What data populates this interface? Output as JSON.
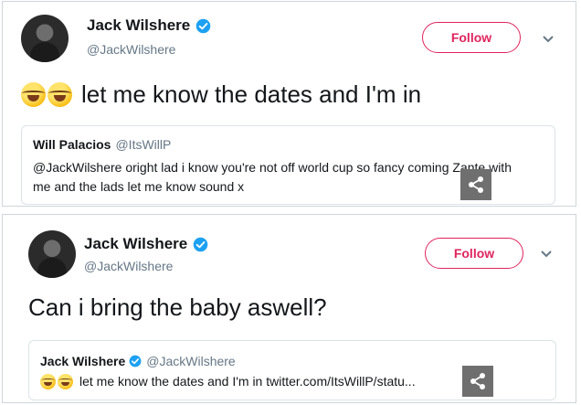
{
  "tweets": [
    {
      "author_name": "Jack Wilshere",
      "author_handle": "@JackWilshere",
      "follow_label": "Follow",
      "text": "let me know the dates and I'm in",
      "emoji_icons": [
        "rolling-on-floor-laughing-icon",
        "rolling-on-floor-laughing-icon"
      ],
      "quote": {
        "name": "Will Palacios",
        "handle": "@ItsWillP",
        "text_line1": "@JackWilshere oright lad i know you're not off world cup so fancy coming Zante with",
        "text_line2": "me and the lads let me know sound x"
      }
    },
    {
      "author_name": "Jack Wilshere",
      "author_handle": "@JackWilshere",
      "follow_label": "Follow",
      "text": "Can i bring the baby aswell?",
      "quote": {
        "name": "Jack Wilshere",
        "handle": "@JackWilshere",
        "text": "let me know the dates and I'm in twitter.com/ItsWillP/statu..."
      }
    }
  ],
  "colors": {
    "follow": "#e0245e",
    "verified": "#1da1f2",
    "handle": "#657786",
    "share_bg": "#6f6f6f"
  }
}
